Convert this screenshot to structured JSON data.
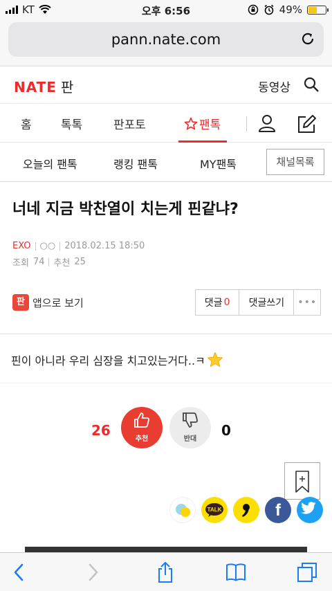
{
  "status_bar": {
    "carrier": "KT",
    "time": "오후 6:56",
    "battery_percent": "49%",
    "battery_level": 0.49
  },
  "browser": {
    "url": "pann.nate.com"
  },
  "header": {
    "logo": "NATE",
    "logo_sub": "판",
    "video_link": "동영상"
  },
  "main_tabs": [
    {
      "label": "홈"
    },
    {
      "label": "톡톡"
    },
    {
      "label": "판포토"
    },
    {
      "label": "팬톡",
      "active": true
    }
  ],
  "sub_tabs": [
    {
      "label": "오늘의 팬톡"
    },
    {
      "label": "랭킹 팬톡"
    },
    {
      "label": "MY팬톡"
    }
  ],
  "channel_button": "채널목록",
  "post": {
    "title": "너네 지금 박찬열이 치는게 핀같냐?",
    "category": "EXO",
    "author": "○○",
    "datetime": "2018.02.15 18:50",
    "views_label": "조회",
    "views": "74",
    "recommend_label": "추천",
    "recommend": "25",
    "app_view_label": "앱으로 보기",
    "comment_label": "댓글",
    "comment_count": "0",
    "write_comment_label": "댓글쓰기",
    "body": "핀이 아니라 우리 심장을 치고있는거다..ㅋ"
  },
  "vote": {
    "up_count": "26",
    "up_label": "추천",
    "down_label": "반대",
    "down_count": "0"
  },
  "share": {
    "talk_label": "TALK"
  },
  "colors": {
    "accent": "#ef2a2a",
    "kakao": "#fadf00",
    "facebook": "#3b5998",
    "twitter": "#1da1f2"
  }
}
